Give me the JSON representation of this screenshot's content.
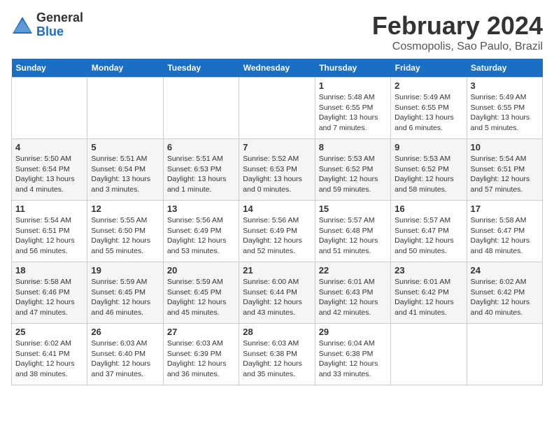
{
  "header": {
    "logo_general": "General",
    "logo_blue": "Blue",
    "title": "February 2024",
    "subtitle": "Cosmopolis, Sao Paulo, Brazil"
  },
  "columns": [
    "Sunday",
    "Monday",
    "Tuesday",
    "Wednesday",
    "Thursday",
    "Friday",
    "Saturday"
  ],
  "weeks": [
    [
      {
        "day": "",
        "info": ""
      },
      {
        "day": "",
        "info": ""
      },
      {
        "day": "",
        "info": ""
      },
      {
        "day": "",
        "info": ""
      },
      {
        "day": "1",
        "info": "Sunrise: 5:48 AM\nSunset: 6:55 PM\nDaylight: 13 hours and 7 minutes."
      },
      {
        "day": "2",
        "info": "Sunrise: 5:49 AM\nSunset: 6:55 PM\nDaylight: 13 hours and 6 minutes."
      },
      {
        "day": "3",
        "info": "Sunrise: 5:49 AM\nSunset: 6:55 PM\nDaylight: 13 hours and 5 minutes."
      }
    ],
    [
      {
        "day": "4",
        "info": "Sunrise: 5:50 AM\nSunset: 6:54 PM\nDaylight: 13 hours and 4 minutes."
      },
      {
        "day": "5",
        "info": "Sunrise: 5:51 AM\nSunset: 6:54 PM\nDaylight: 13 hours and 3 minutes."
      },
      {
        "day": "6",
        "info": "Sunrise: 5:51 AM\nSunset: 6:53 PM\nDaylight: 13 hours and 1 minute."
      },
      {
        "day": "7",
        "info": "Sunrise: 5:52 AM\nSunset: 6:53 PM\nDaylight: 13 hours and 0 minutes."
      },
      {
        "day": "8",
        "info": "Sunrise: 5:53 AM\nSunset: 6:52 PM\nDaylight: 12 hours and 59 minutes."
      },
      {
        "day": "9",
        "info": "Sunrise: 5:53 AM\nSunset: 6:52 PM\nDaylight: 12 hours and 58 minutes."
      },
      {
        "day": "10",
        "info": "Sunrise: 5:54 AM\nSunset: 6:51 PM\nDaylight: 12 hours and 57 minutes."
      }
    ],
    [
      {
        "day": "11",
        "info": "Sunrise: 5:54 AM\nSunset: 6:51 PM\nDaylight: 12 hours and 56 minutes."
      },
      {
        "day": "12",
        "info": "Sunrise: 5:55 AM\nSunset: 6:50 PM\nDaylight: 12 hours and 55 minutes."
      },
      {
        "day": "13",
        "info": "Sunrise: 5:56 AM\nSunset: 6:49 PM\nDaylight: 12 hours and 53 minutes."
      },
      {
        "day": "14",
        "info": "Sunrise: 5:56 AM\nSunset: 6:49 PM\nDaylight: 12 hours and 52 minutes."
      },
      {
        "day": "15",
        "info": "Sunrise: 5:57 AM\nSunset: 6:48 PM\nDaylight: 12 hours and 51 minutes."
      },
      {
        "day": "16",
        "info": "Sunrise: 5:57 AM\nSunset: 6:47 PM\nDaylight: 12 hours and 50 minutes."
      },
      {
        "day": "17",
        "info": "Sunrise: 5:58 AM\nSunset: 6:47 PM\nDaylight: 12 hours and 48 minutes."
      }
    ],
    [
      {
        "day": "18",
        "info": "Sunrise: 5:58 AM\nSunset: 6:46 PM\nDaylight: 12 hours and 47 minutes."
      },
      {
        "day": "19",
        "info": "Sunrise: 5:59 AM\nSunset: 6:45 PM\nDaylight: 12 hours and 46 minutes."
      },
      {
        "day": "20",
        "info": "Sunrise: 5:59 AM\nSunset: 6:45 PM\nDaylight: 12 hours and 45 minutes."
      },
      {
        "day": "21",
        "info": "Sunrise: 6:00 AM\nSunset: 6:44 PM\nDaylight: 12 hours and 43 minutes."
      },
      {
        "day": "22",
        "info": "Sunrise: 6:01 AM\nSunset: 6:43 PM\nDaylight: 12 hours and 42 minutes."
      },
      {
        "day": "23",
        "info": "Sunrise: 6:01 AM\nSunset: 6:42 PM\nDaylight: 12 hours and 41 minutes."
      },
      {
        "day": "24",
        "info": "Sunrise: 6:02 AM\nSunset: 6:42 PM\nDaylight: 12 hours and 40 minutes."
      }
    ],
    [
      {
        "day": "25",
        "info": "Sunrise: 6:02 AM\nSunset: 6:41 PM\nDaylight: 12 hours and 38 minutes."
      },
      {
        "day": "26",
        "info": "Sunrise: 6:03 AM\nSunset: 6:40 PM\nDaylight: 12 hours and 37 minutes."
      },
      {
        "day": "27",
        "info": "Sunrise: 6:03 AM\nSunset: 6:39 PM\nDaylight: 12 hours and 36 minutes."
      },
      {
        "day": "28",
        "info": "Sunrise: 6:03 AM\nSunset: 6:38 PM\nDaylight: 12 hours and 35 minutes."
      },
      {
        "day": "29",
        "info": "Sunrise: 6:04 AM\nSunset: 6:38 PM\nDaylight: 12 hours and 33 minutes."
      },
      {
        "day": "",
        "info": ""
      },
      {
        "day": "",
        "info": ""
      }
    ]
  ]
}
